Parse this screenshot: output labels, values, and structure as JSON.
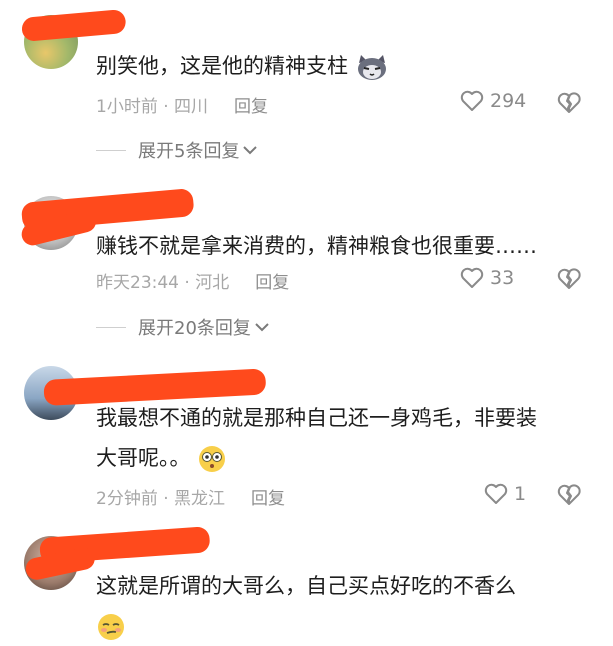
{
  "comments": [
    {
      "text": "别笑他，这是他的精神支柱",
      "emoji": "cat-face-emoji",
      "meta": "1小时前 · 四川",
      "reply_label": "回复",
      "likes": "294",
      "expand_label": "展开5条回复"
    },
    {
      "text": "赚钱不就是拿来消费的，精神粮食也很重要……",
      "meta": "昨天23:44 · 河北",
      "reply_label": "回复",
      "likes": "33",
      "expand_label": "展开20条回复"
    },
    {
      "text_line1": "我最想不通的就是那种自己还一身鸡毛，非要装",
      "text_line2": "大哥呢。。",
      "emoji": "flushed-face-emoji",
      "meta": "2分钟前 · 黑龙江",
      "reply_label": "回复",
      "likes": "1"
    },
    {
      "text": "这就是所谓的大哥么，自己买点好吃的不香么",
      "emoji": "smirking-face-emoji"
    }
  ],
  "colors": {
    "redaction": "#ff4a1c",
    "meta": "#a7a7a7"
  }
}
